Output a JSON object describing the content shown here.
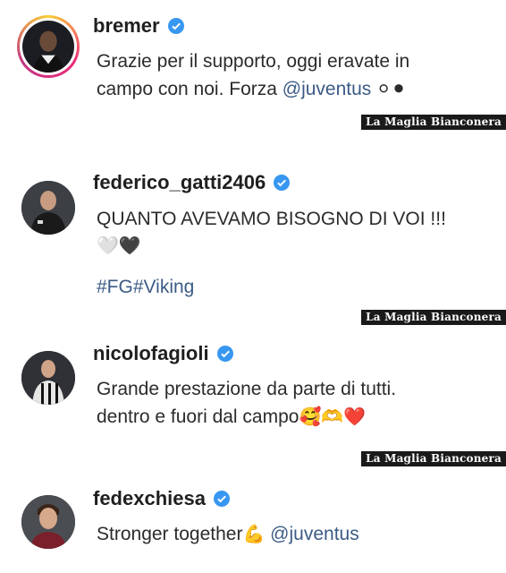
{
  "posts": [
    {
      "username": "bremer",
      "line1": "Grazie per il supporto, oggi eravate in",
      "line2_prefix": "campo con noi. Forza ",
      "line2_mention": "@juventus",
      "line2_emoji": " ⚪⚫"
    },
    {
      "username": "federico_gatti2406",
      "line1": "QUANTO AVEVAMO BISOGNO DI VOI !!!",
      "line2_emoji": "🤍🖤",
      "hashtags": "#FG#Viking"
    },
    {
      "username": "nicolofagioli",
      "line1": "Grande prestazione da parte di tutti.",
      "line2_prefix": "dentro e fuori dal campo",
      "line2_emoji": "🥰🫶❤️"
    },
    {
      "username": "fedexchiesa",
      "line1_prefix": "Stronger together",
      "line1_emoji": "💪",
      "line1_mention": " @juventus"
    }
  ],
  "watermark": "La Maglia Bianconera",
  "colors": {
    "verified": "#3897f0",
    "mention": "#3b5b86",
    "watermark_bg": "#1a1a1a"
  }
}
